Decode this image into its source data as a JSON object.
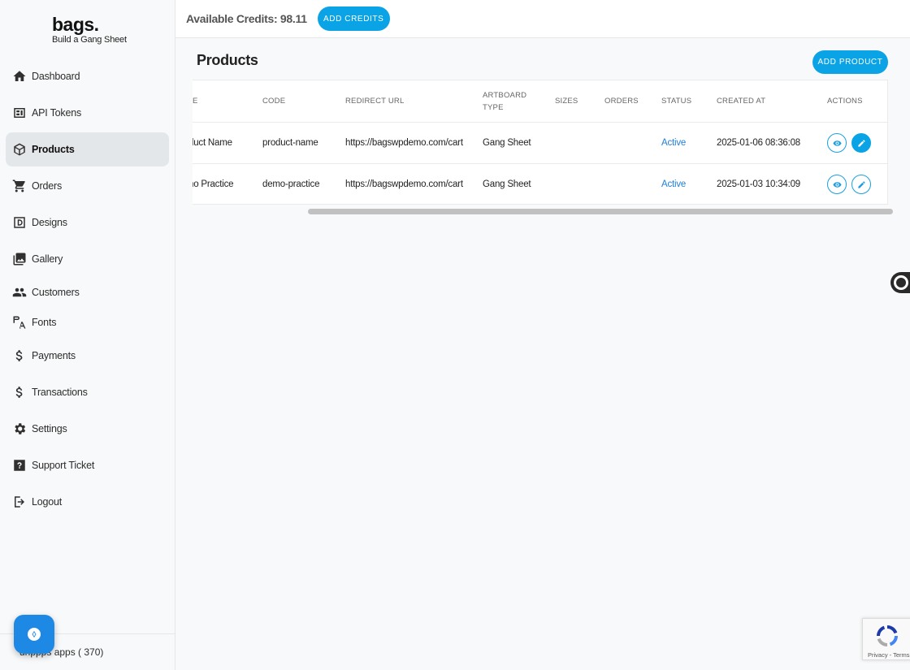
{
  "logo": {
    "name": "bags.",
    "tagline": "Build a Gang Sheet"
  },
  "sidebar": {
    "items": [
      {
        "label": "Dashboard",
        "icon": "home-icon"
      },
      {
        "label": "API Tokens",
        "icon": "api-tokens-icon"
      },
      {
        "label": "Products",
        "icon": "package-icon",
        "active": true
      },
      {
        "label": "Orders",
        "icon": "cart-icon"
      },
      {
        "label": "Designs",
        "icon": "designs-icon"
      },
      {
        "label": "Gallery",
        "icon": "gallery-icon"
      },
      {
        "label": "Customers",
        "icon": "customers-icon"
      },
      {
        "label": "Fonts",
        "icon": "fonts-icon"
      },
      {
        "label": "Payments",
        "icon": "dollar-icon"
      },
      {
        "label": "Transactions",
        "icon": "dollar-icon"
      },
      {
        "label": "Settings",
        "icon": "gear-icon"
      },
      {
        "label": "Support Ticket",
        "icon": "help-icon"
      },
      {
        "label": "Logout",
        "icon": "logout-icon"
      }
    ],
    "footer": "drippps apps ( 370)"
  },
  "topbar": {
    "credits_label": "Available Credits: 98.11",
    "add_credits": "ADD CREDITS"
  },
  "main": {
    "title": "Products",
    "add_product": "ADD PRODUCT",
    "columns": [
      "E",
      "CODE",
      "REDIRECT URL",
      "ARTBOARD",
      "TYPE",
      "SIZES",
      "ORDERS",
      "STATUS",
      "CREATED AT",
      "ACTIONS"
    ],
    "rows": [
      {
        "name": "duct Name",
        "code": "product-name",
        "url": "https://bagswpdemo.com/cart",
        "artboard": "Gang Sheet",
        "sizes": "",
        "orders": "",
        "status": "Active",
        "created": "2025-01-06 08:36:08"
      },
      {
        "name": "no Practice",
        "code": "demo-practice",
        "url": "https://bagswpdemo.com/cart",
        "artboard": "Gang Sheet",
        "sizes": "",
        "orders": "",
        "status": "Active",
        "created": "2025-01-03 10:34:09"
      }
    ]
  },
  "recaptcha": {
    "links": "Privacy - Terms"
  },
  "colors": {
    "accent": "#0aa3e6",
    "status_active": "#1f7fd6"
  }
}
